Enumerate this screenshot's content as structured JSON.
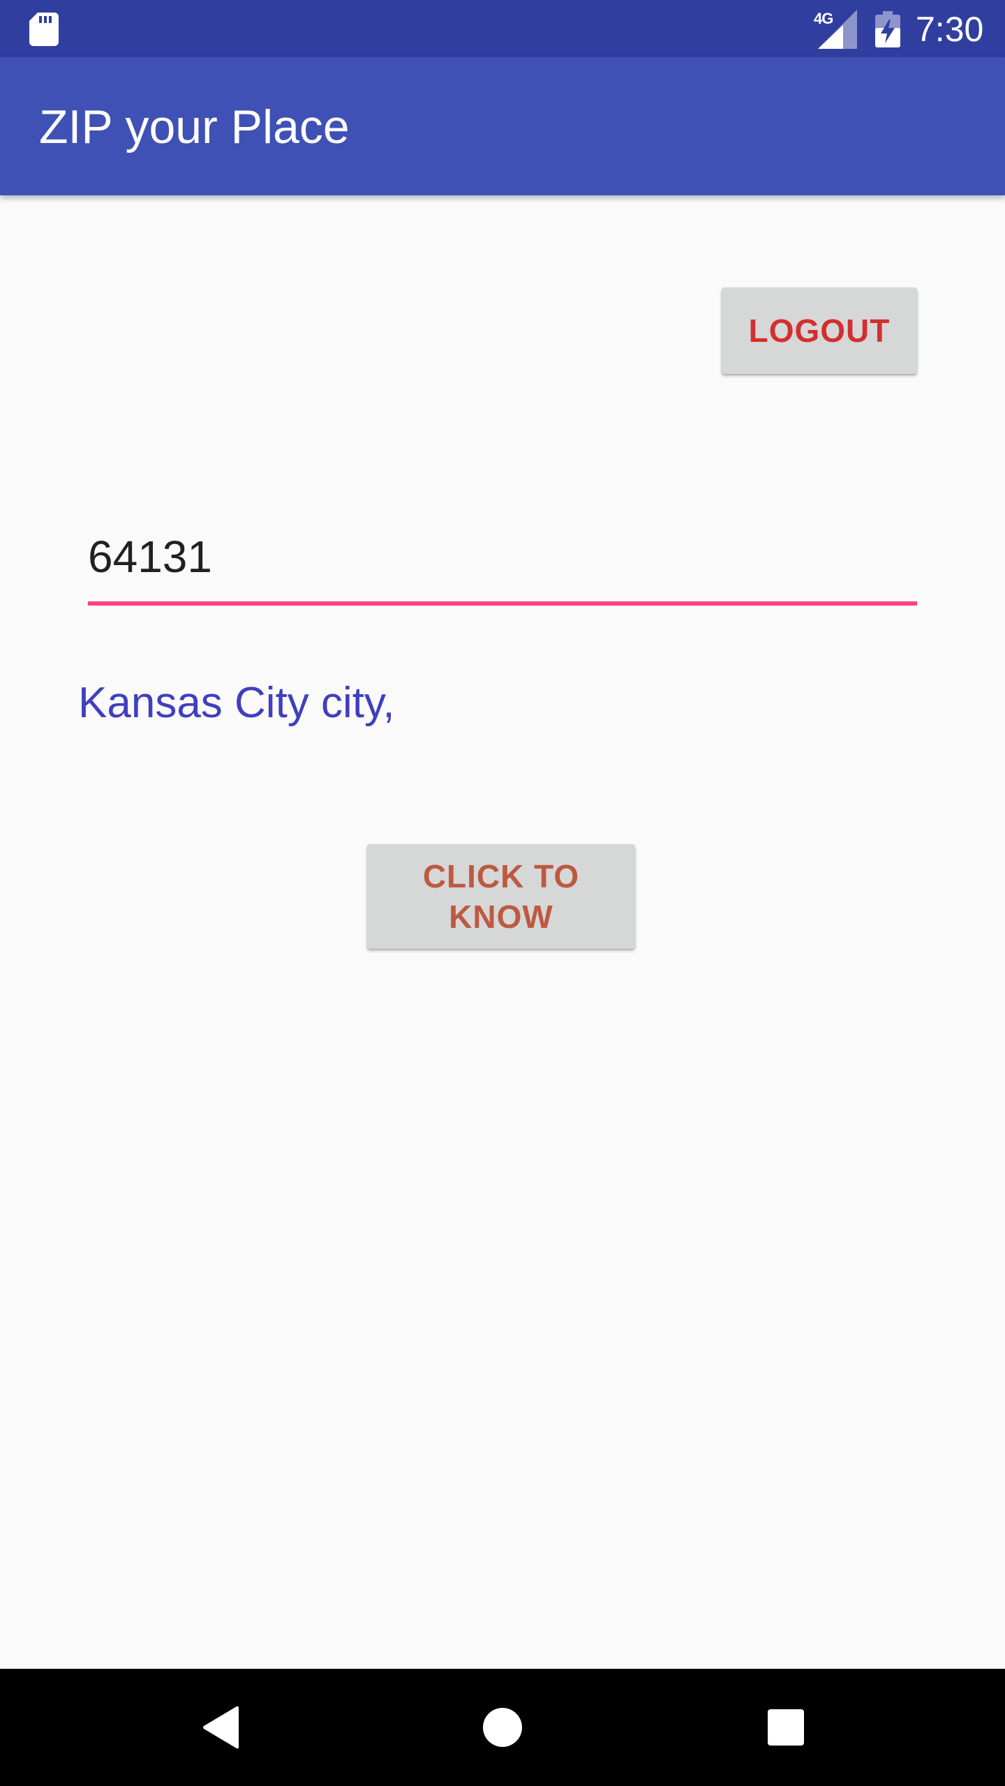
{
  "status_bar": {
    "network": "4G",
    "time": "7:30",
    "icons": [
      "sd-card-icon",
      "signal-icon",
      "battery-charging-icon"
    ]
  },
  "app_bar": {
    "title": "ZIP your Place"
  },
  "main": {
    "logout_label": "LOGOUT",
    "zip_value": "64131",
    "result_text": "Kansas City city,",
    "know_label": "CLICK TO KNOW"
  },
  "nav_bar": {
    "icons": [
      "back-icon",
      "home-icon",
      "recent-apps-icon"
    ]
  },
  "colors": {
    "status_bar": "#303f9f",
    "app_bar": "#3f51b5",
    "accent": "#ff4081",
    "logout_text": "#d32f2f",
    "know_text": "#bc5a41",
    "result_text": "#3f3fbf",
    "button_bg": "#d6d7d7"
  }
}
